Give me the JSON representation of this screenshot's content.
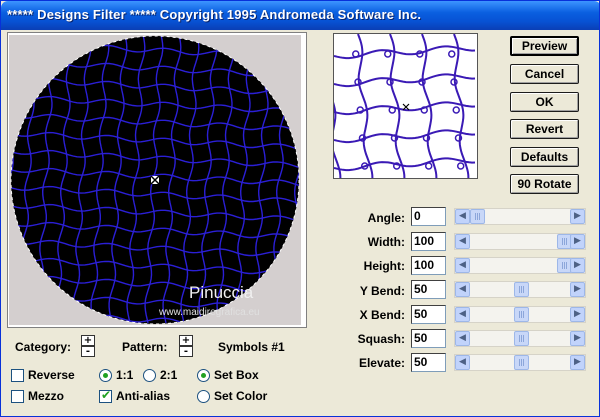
{
  "window": {
    "title": "***** Designs Filter *****  Copyright 1995 Andromeda Software Inc."
  },
  "preview": {
    "watermark_name": "Pinuccia",
    "watermark_url": "www.maidiregrafica.eu",
    "background_color": "#d4cfcf",
    "mesh_color": "#2b1fd6"
  },
  "buttons": [
    {
      "label": "Preview",
      "default": true
    },
    {
      "label": "Cancel"
    },
    {
      "label": "OK"
    },
    {
      "label": "Revert"
    },
    {
      "label": "Defaults"
    },
    {
      "label": "90 Rotate"
    }
  ],
  "params": [
    {
      "label": "Angle:",
      "value": "0"
    },
    {
      "label": "Width:",
      "value": "100"
    },
    {
      "label": "Height:",
      "value": "100"
    },
    {
      "label": "Y Bend:",
      "value": "50"
    },
    {
      "label": "X Bend:",
      "value": "50"
    },
    {
      "label": "Squash:",
      "value": "50"
    },
    {
      "label": "Elevate:",
      "value": "50"
    }
  ],
  "slider_levels": [
    0,
    1,
    1,
    0.5,
    0.5,
    0.5,
    0.5
  ],
  "bottom": {
    "category_label": "Category:",
    "pattern_label": "Pattern:",
    "pattern_name": "Symbols #1",
    "plus": "+",
    "minus": "-",
    "reverse_label": "Reverse",
    "mezzo_label": "Mezzo",
    "ratio_1_label": "1:1",
    "ratio_2_label": "2:1",
    "antialias_label": "Anti-alias",
    "setbox_label": "Set Box",
    "setcolor_label": "Set Color",
    "reverse_checked": false,
    "mezzo_checked": false,
    "antialias_checked": true,
    "ratio_selected": "1:1",
    "mode_selected": "Set Box"
  }
}
